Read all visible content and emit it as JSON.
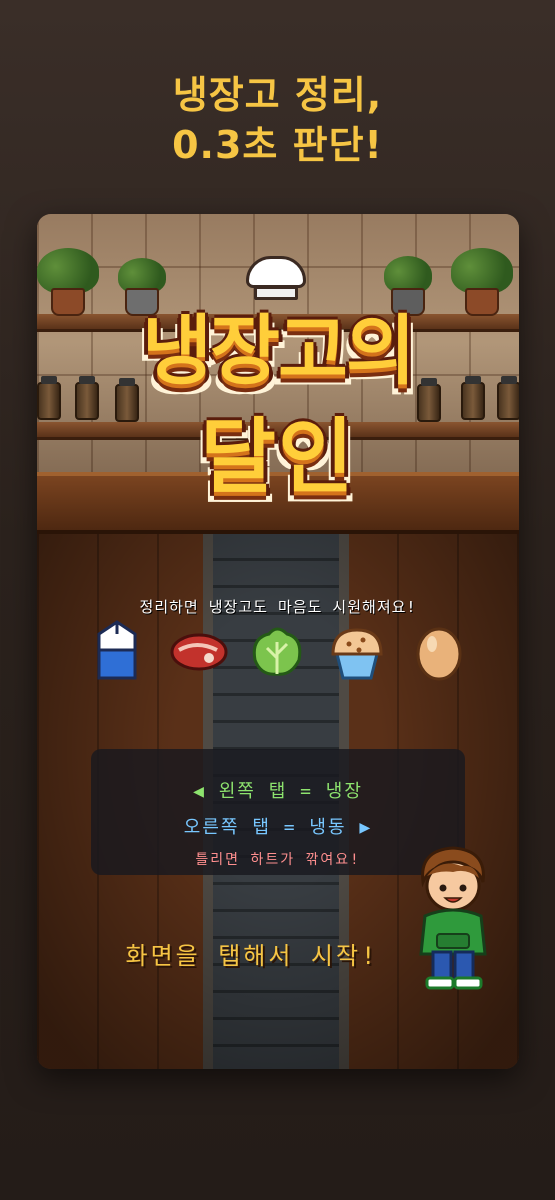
{
  "headline": {
    "line1": "냉장고 정리,",
    "line2": "0.3초 판단!"
  },
  "logo": {
    "line1": "냉장고의",
    "line2": "달인"
  },
  "tagline": "정리하면 냉장고도 마음도 시원해져요!",
  "items": [
    "milk-carton",
    "steak",
    "lettuce",
    "muffin",
    "egg"
  ],
  "instructions": {
    "left": "◀ 왼쪽 탭 = 냉장",
    "right": "오른쪽 탭 = 냉동 ▶",
    "warning": "틀리면 하트가 깎여요!"
  },
  "start_prompt": "화면을 탭해서 시작!",
  "colors": {
    "headline": "#f6c544",
    "left_hint": "#8de36e",
    "right_hint": "#78c7ff",
    "warning": "#ff8f8f"
  }
}
